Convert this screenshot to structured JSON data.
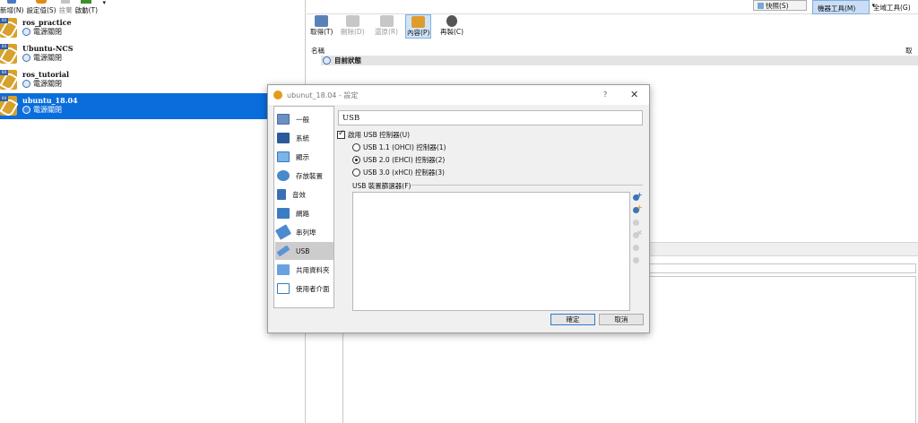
{
  "toolbar": {
    "new_label": "新增(N)",
    "settings_label": "設定值(S)",
    "discard_label": "捨棄",
    "start_label": "啟動(T)"
  },
  "vms": [
    {
      "name": "ros_practice",
      "state": "電源關閉",
      "os_badge": "64"
    },
    {
      "name": "Ubuntu-NCS",
      "state": "電源關閉",
      "os_badge": "64"
    },
    {
      "name": "ros_tutorial",
      "state": "電源關閉",
      "os_badge": "64"
    },
    {
      "name": "ubuntu_18.04",
      "state": "電源關閉",
      "os_badge": "64",
      "selected": true
    }
  ],
  "details_toolbar": {
    "take": "取得(T)",
    "delete": "刪除(D)",
    "restore": "還原(R)",
    "properties": "內容(P)",
    "clone": "再製(C)"
  },
  "top_right": {
    "snapshots": "快照(S)",
    "machine_tools": "機器工具(M)",
    "global_tools": "全域工具(G)"
  },
  "snapshot_table": {
    "col_name": "名稱",
    "col_taken": "取得",
    "current_state": "目前狀態"
  },
  "dialog": {
    "title": "ubunut_18.04 - 設定",
    "help": "?",
    "categories": [
      {
        "label": "一般",
        "icon": "general-icon"
      },
      {
        "label": "系統",
        "icon": "system-icon"
      },
      {
        "label": "顯示",
        "icon": "display-icon"
      },
      {
        "label": "存放裝置",
        "icon": "storage-icon"
      },
      {
        "label": "音效",
        "icon": "audio-icon"
      },
      {
        "label": "網路",
        "icon": "network-icon"
      },
      {
        "label": "串列埠",
        "icon": "serial-port-icon"
      },
      {
        "label": "USB",
        "icon": "usb-icon",
        "selected": true
      },
      {
        "label": "共用資料夾",
        "icon": "shared-folder-icon"
      },
      {
        "label": "使用者介面",
        "icon": "user-interface-icon"
      }
    ],
    "section_title": "USB",
    "enable_usb": {
      "label": "啟用 USB 控制器(U)",
      "checked": true
    },
    "controllers": [
      {
        "label": "USB 1.1 (OHCI) 控制器(1)",
        "selected": false
      },
      {
        "label": "USB 2.0 (EHCI) 控制器(2)",
        "selected": true
      },
      {
        "label": "USB 3.0 (xHCI) 控制器(3)",
        "selected": false
      }
    ],
    "filters_label": "USB 裝置篩選器(F)",
    "ok": "確定",
    "cancel": "取消"
  },
  "colors": {
    "selection": "#0a6ddc",
    "accent": "#2b79d0"
  }
}
